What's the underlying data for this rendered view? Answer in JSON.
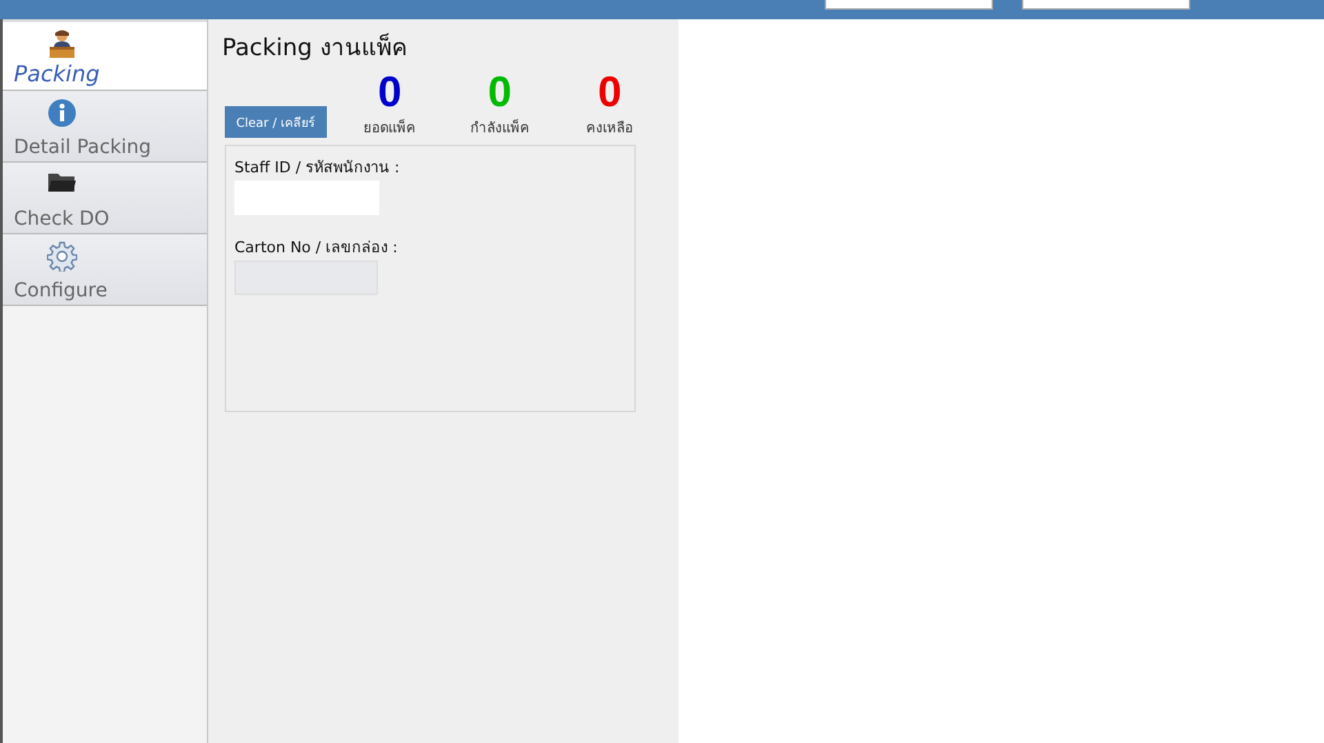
{
  "sidebar": {
    "items": [
      {
        "label": "Packing",
        "selected": true
      },
      {
        "label": "Detail Packing",
        "selected": false
      },
      {
        "label": "Check DO",
        "selected": false
      },
      {
        "label": "Configure",
        "selected": false
      }
    ]
  },
  "page": {
    "title": "Packing งานแพ็ค",
    "clear_button": "Clear / เคลียร์",
    "counters": [
      {
        "value": "0",
        "label": "ยอดแพ็ค",
        "color": "#0000cc"
      },
      {
        "value": "0",
        "label": "กำลังแพ็ค",
        "color": "#00bb00"
      },
      {
        "value": "0",
        "label": "คงเหลือ",
        "color": "#ee0000"
      }
    ],
    "fields": [
      {
        "label": "Staff ID / รหัสพนักงาน :",
        "disabled": false
      },
      {
        "label": "Carton No / เลขกล่อง :",
        "disabled": true
      }
    ]
  }
}
